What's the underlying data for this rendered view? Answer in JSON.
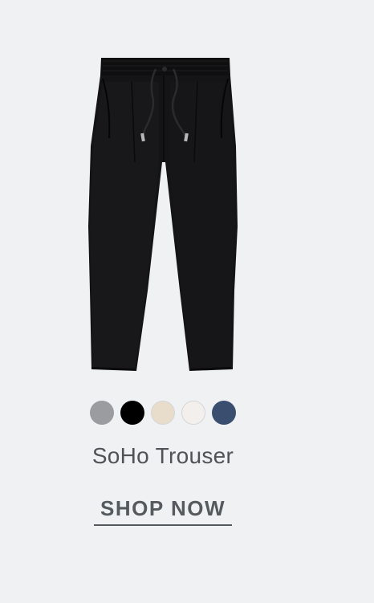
{
  "product": {
    "name": "SoHo Trouser",
    "image_icon": "trouser-image"
  },
  "swatches": [
    {
      "color": "#9a9ca0",
      "light": false
    },
    {
      "color": "#000000",
      "light": false
    },
    {
      "color": "#e8dccb",
      "light": true
    },
    {
      "color": "#f2efed",
      "light": true
    },
    {
      "color": "#3a4e70",
      "light": false
    }
  ],
  "cta": {
    "label": "SHOP NOW"
  }
}
